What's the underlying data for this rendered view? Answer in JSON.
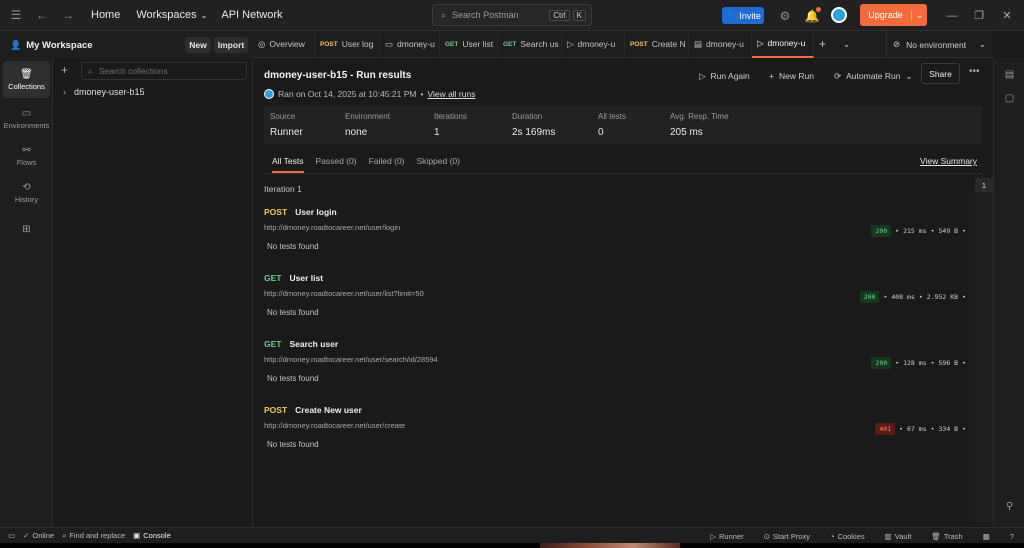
{
  "topbar": {
    "home": "Home",
    "workspaces": "Workspaces",
    "api_network": "API Network",
    "search_placeholder": "Search Postman",
    "search_kbd_ctrl": "Ctrl",
    "search_kbd_k": "K",
    "invite": "Invite",
    "upgrade": "Upgrade"
  },
  "workspace": {
    "name": "My Workspace",
    "new_button": "New",
    "import_button": "Import"
  },
  "rail": [
    {
      "label": "Collections",
      "icon": "collections-icon"
    },
    {
      "label": "Environments",
      "icon": "environments-icon"
    },
    {
      "label": "Flows",
      "icon": "flows-icon"
    },
    {
      "label": "History",
      "icon": "history-icon"
    }
  ],
  "sidebar": {
    "search_placeholder": "Search collections",
    "collection": "dmoney-user-b15"
  },
  "tabs": [
    {
      "method": "",
      "label": "Overview"
    },
    {
      "method": "POST",
      "label": "User log"
    },
    {
      "method": "",
      "label": "dmoney-u"
    },
    {
      "method": "GET",
      "label": "User list"
    },
    {
      "method": "GET",
      "label": "Search us"
    },
    {
      "method": "",
      "label": "dmoney-u"
    },
    {
      "method": "POST",
      "label": "Create N"
    },
    {
      "method": "",
      "label": "dmoney-u"
    },
    {
      "method": "",
      "label": "dmoney-u"
    }
  ],
  "environment": "No environment",
  "run": {
    "title": "dmoney-user-b15 - Run results",
    "ran_on": "Ran on Oct 14, 2025 at 10:45:21 PM",
    "view_all_runs": "View all runs",
    "run_again": "Run Again",
    "new_run": "New Run",
    "automate_run": "Automate Run",
    "share": "Share"
  },
  "summary": [
    {
      "label": "Source",
      "value": "Runner"
    },
    {
      "label": "Environment",
      "value": "none"
    },
    {
      "label": "Iterations",
      "value": "1"
    },
    {
      "label": "Duration",
      "value": "2s 169ms"
    },
    {
      "label": "All tests",
      "value": "0"
    },
    {
      "label": "Avg. Resp. Time",
      "value": "205 ms"
    }
  ],
  "filters": {
    "all": "All Tests",
    "passed": "Passed (0)",
    "failed": "Failed (0)",
    "skipped": "Skipped (0)",
    "view_summary": "View Summary"
  },
  "iteration": {
    "label": "Iteration 1",
    "badge": "1"
  },
  "requests": [
    {
      "method": "POST",
      "name": "User login",
      "url": "http://dmoney.roadtocareer.net/user/login",
      "status": "200",
      "time": "215 ms",
      "size": "549 B",
      "note": "No tests found"
    },
    {
      "method": "GET",
      "name": "User list",
      "url": "http://dmoney.roadtocareer.net/user/list?limit=50",
      "status": "200",
      "time": "408 ms",
      "size": "2.952 KB",
      "note": "No tests found"
    },
    {
      "method": "GET",
      "name": "Search user",
      "url": "http://dmoney.roadtocareer.net/user/search/id/28594",
      "status": "200",
      "time": "128 ms",
      "size": "596 B",
      "note": "No tests found"
    },
    {
      "method": "POST",
      "name": "Create New user",
      "url": "http://dmoney.roadtocareer.net/user/create",
      "status": "401",
      "time": "67 ms",
      "size": "334 B",
      "note": "No tests found"
    }
  ],
  "footer": {
    "online": "Online",
    "find_replace": "Find and replace",
    "console": "Console",
    "runner": "Runner",
    "start_proxy": "Start Proxy",
    "cookies": "Cookies",
    "vault": "Vault",
    "trash": "Trash"
  },
  "colors": {
    "accent": "#f26b3a",
    "invite": "#1f6bd1",
    "post": "#f5c453",
    "get": "#6bcf8f",
    "ok": "#6bd58c",
    "error": "#ff8a6d"
  }
}
